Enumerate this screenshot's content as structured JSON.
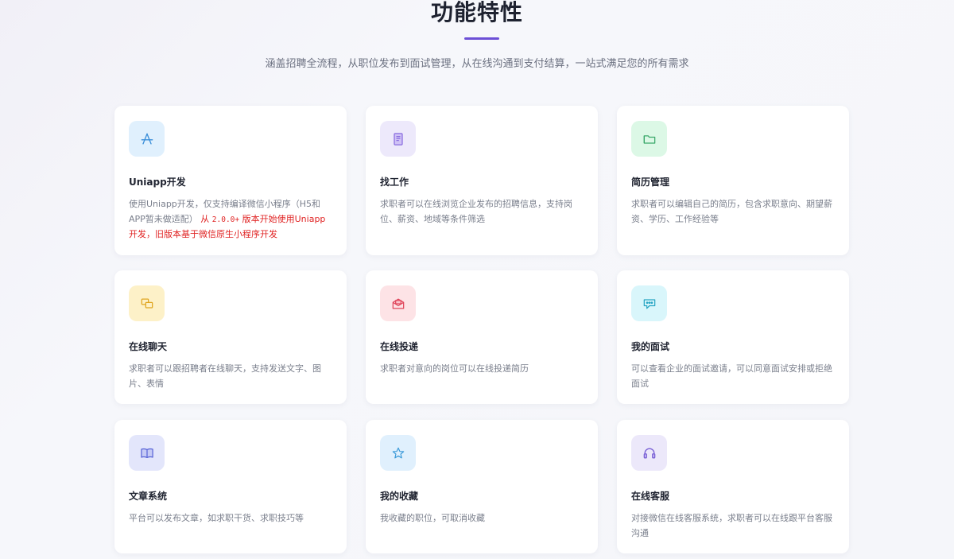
{
  "header": {
    "title": "功能特性",
    "subtitle": "涵盖招聘全流程，从职位发布到面试管理，从在线沟通到支付结算，一站式满足您的所有需求"
  },
  "features": [
    {
      "title": "Uniapp开发",
      "desc_plain": "使用Uniapp开发，仅支持编译微信小程序（H5和APP暂未做适配）",
      "desc_red_prefix": "从",
      "desc_version": "2.0.0+",
      "desc_red_suffix": "版本开始使用Uniapp开发，旧版本基于微信原生小程序开发",
      "icon": "app-store-icon",
      "icon_bg": "#e0f0fd",
      "icon_color": "#3b8fd9"
    },
    {
      "title": "找工作",
      "desc": "求职者可以在线浏览企业发布的招聘信息，支持岗位、薪资、地域等条件筛选",
      "icon": "document-icon",
      "icon_bg": "#ede9fb",
      "icon_color": "#8a6de0"
    },
    {
      "title": "简历管理",
      "desc": "求职者可以编辑自己的简历，包含求职意向、期望薪资、学历、工作经验等",
      "icon": "folder-icon",
      "icon_bg": "#dcf8e6",
      "icon_color": "#3aa86a"
    },
    {
      "title": "在线聊天",
      "desc": "求职者可以跟招聘者在线聊天，支持发送文字、图片、表情",
      "icon": "chat-icon",
      "icon_bg": "#fdf1c8",
      "icon_color": "#e0a520"
    },
    {
      "title": "在线投递",
      "desc": "求职者对意向的岗位可以在线投递简历",
      "icon": "mail-icon",
      "icon_bg": "#fde3e6",
      "icon_color": "#e0475c"
    },
    {
      "title": "我的面试",
      "desc": "可以查看企业的面试邀请，可以同意面试安排或拒绝面试",
      "icon": "message-bubble-icon",
      "icon_bg": "#d9f6fb",
      "icon_color": "#2aa6c4"
    },
    {
      "title": "文章系统",
      "desc": "平台可以发布文章，如求职干货、求职技巧等",
      "icon": "book-icon",
      "icon_bg": "#e3e6fb",
      "icon_color": "#5b67d8"
    },
    {
      "title": "我的收藏",
      "desc": "我收藏的职位，可取消收藏",
      "icon": "star-icon",
      "icon_bg": "#e0f0fd",
      "icon_color": "#3b9ad9"
    },
    {
      "title": "在线客服",
      "desc": "对接微信在线客服系统，求职者可以在线跟平台客服沟通",
      "icon": "headset-icon",
      "icon_bg": "#ece8fa",
      "icon_color": "#7b62d6"
    }
  ]
}
